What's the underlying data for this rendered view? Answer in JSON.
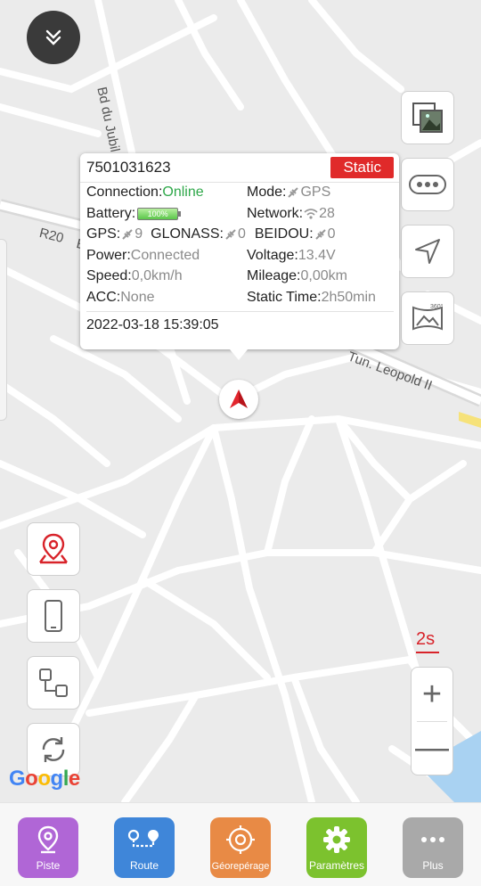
{
  "map": {
    "street_labels": [
      "Bd du Jubil",
      "R20",
      "E",
      "Tun. Leopold II"
    ],
    "provider": "Google",
    "scale_label": "2s",
    "zoom_in_label": "+",
    "zoom_out_label": "—"
  },
  "popup": {
    "device_id": "7501031623",
    "status_badge": "Static",
    "connection_label": "Connection:",
    "connection_value": "Online",
    "mode_label": "Mode:",
    "mode_value": "GPS",
    "battery_label": "Battery:",
    "battery_value": "100%",
    "battery_level": 100,
    "network_label": "Network:",
    "network_value": "28",
    "gps_label": "GPS:",
    "gps_value": "9",
    "glonass_label": "GLONASS:",
    "glonass_value": "0",
    "beidou_label": "BEIDOU:",
    "beidou_value": "0",
    "power_label": "Power:",
    "power_value": "Connected",
    "voltage_label": "Voltage:",
    "voltage_value": "13.4V",
    "speed_label": "Speed:",
    "speed_value": "0,0km/h",
    "mileage_label": "Mileage:",
    "mileage_value": "0,00km",
    "acc_label": "ACC:",
    "acc_value": "None",
    "static_time_label": "Static Time:",
    "static_time_value": "2h50min",
    "timestamp": "2022-03-18 15:39:05"
  },
  "right_controls": [
    "map-layer-icon",
    "more-dots-icon",
    "navigate-arrow-icon",
    "panorama-360-icon"
  ],
  "panorama_badge": "360°",
  "left_controls": [
    "location-pin-icon",
    "phone-icon",
    "route-nodes-icon",
    "refresh-icon"
  ],
  "bottom_tabs": [
    {
      "label": "Piste",
      "color": "#b066d6"
    },
    {
      "label": "Route",
      "color": "#3f86d9"
    },
    {
      "label": "Géorepérage",
      "color": "#e88a45"
    },
    {
      "label": "Paramètres",
      "color": "#7cc22e"
    },
    {
      "label": "Plus",
      "color": "#a9a9a9"
    }
  ],
  "colors": {
    "accent_red": "#d8232a",
    "badge_red": "#e02a2a",
    "online_green": "#2fa84a"
  }
}
